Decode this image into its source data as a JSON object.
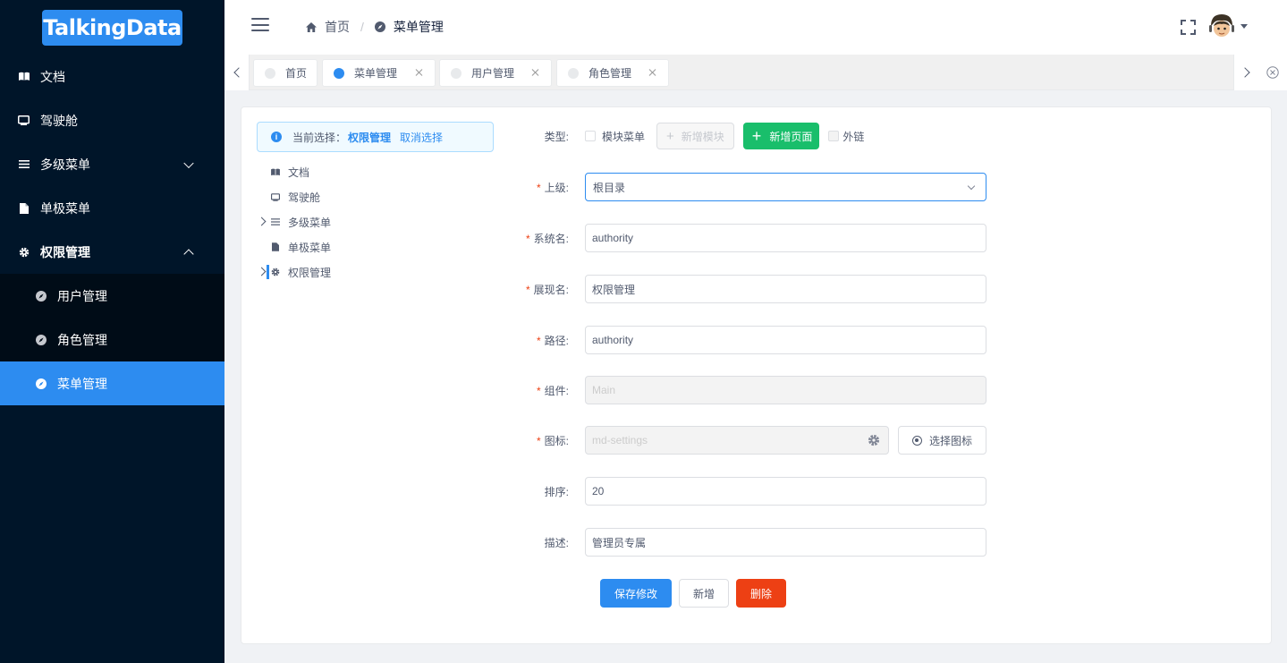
{
  "brand": {
    "logo_text": "TalkingData"
  },
  "sidebar": {
    "items": [
      {
        "label": "文档",
        "icon": "book-icon"
      },
      {
        "label": "驾驶舱",
        "icon": "monitor-icon"
      },
      {
        "label": "多级菜单",
        "icon": "list-icon",
        "expanded": false
      },
      {
        "label": "单极菜单",
        "icon": "document-icon"
      },
      {
        "label": "权限管理",
        "icon": "gear-icon",
        "expanded": true
      }
    ],
    "subitems": [
      {
        "label": "用户管理",
        "icon": "compass-icon"
      },
      {
        "label": "角色管理",
        "icon": "compass-icon"
      },
      {
        "label": "菜单管理",
        "icon": "compass-icon",
        "active": true
      }
    ]
  },
  "header": {
    "breadcrumb": [
      {
        "label": "首页",
        "icon": "home-icon"
      },
      {
        "label": "菜单管理",
        "icon": "compass-icon"
      }
    ],
    "breadcrumb_separator": "/"
  },
  "tabs": [
    {
      "label": "首页",
      "closable": false,
      "active": false
    },
    {
      "label": "菜单管理",
      "closable": true,
      "active": true
    },
    {
      "label": "用户管理",
      "closable": true,
      "active": false
    },
    {
      "label": "角色管理",
      "closable": true,
      "active": false
    }
  ],
  "alert": {
    "prefix": "当前选择：",
    "selected": "权限管理",
    "cancel": "取消选择"
  },
  "tree": [
    {
      "label": "文档",
      "icon": "book-icon",
      "expandable": false
    },
    {
      "label": "驾驶舱",
      "icon": "monitor-icon",
      "expandable": false
    },
    {
      "label": "多级菜单",
      "icon": "list-icon",
      "expandable": true
    },
    {
      "label": "单极菜单",
      "icon": "document-icon",
      "expandable": false
    },
    {
      "label": "权限管理",
      "icon": "gear-icon",
      "expandable": true,
      "selected": true
    }
  ],
  "form": {
    "type": {
      "label": "类型:",
      "module_checkbox": "模块菜单",
      "add_module": "新增模块",
      "add_page": "新增页面",
      "external_checkbox": "外链"
    },
    "parent": {
      "label": "上级:",
      "value": "根目录"
    },
    "system_name": {
      "label": "系统名:",
      "value": "authority"
    },
    "display_name": {
      "label": "展现名:",
      "value": "权限管理"
    },
    "path": {
      "label": "路径:",
      "value": "authority"
    },
    "component": {
      "label": "组件:",
      "value": "Main"
    },
    "icon": {
      "label": "图标:",
      "value": "md-settings",
      "choose_button": "选择图标"
    },
    "order": {
      "label": "排序:",
      "value": "20"
    },
    "description": {
      "label": "描述:",
      "value": "管理员专属"
    },
    "required_mark": "*"
  },
  "actions": {
    "save": "保存修改",
    "add": "新增",
    "delete": "删除"
  },
  "colors": {
    "sidebar_bg": "#001529",
    "primary": "#2d8cf0",
    "success": "#19be6b",
    "danger": "#ed4014"
  }
}
